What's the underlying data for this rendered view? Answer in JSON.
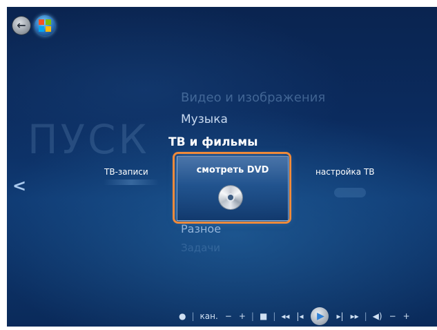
{
  "header": {
    "big_label": "ПУСК"
  },
  "menu": {
    "faded_top": "Видео и изображения",
    "music": "Музыка",
    "tv_movies": "ТВ и фильмы",
    "misc": "Разное",
    "faded_bottom": "Задачи"
  },
  "row": {
    "left_item": "ТВ-записи",
    "selected_item": "смотреть DVD",
    "right_item": "настройка ТВ"
  },
  "icons": {
    "back": "back-arrow-icon",
    "start": "windows-start-orb-icon",
    "dvd": "dvd-disc-icon",
    "scroll_left": "chevron-left-icon"
  },
  "transport": {
    "record": "●",
    "channel_label": "кан.",
    "channel_minus": "−",
    "channel_plus": "+",
    "stop": "■",
    "rewind": "◂◂",
    "prev": "|◂",
    "play": "▶",
    "next": "▸|",
    "fast_forward": "▸▸",
    "volume": "◀)",
    "volume_minus": "−",
    "volume_plus": "+"
  },
  "colors": {
    "highlight_border": "#f08a3a",
    "background": "#0b2b5e"
  }
}
